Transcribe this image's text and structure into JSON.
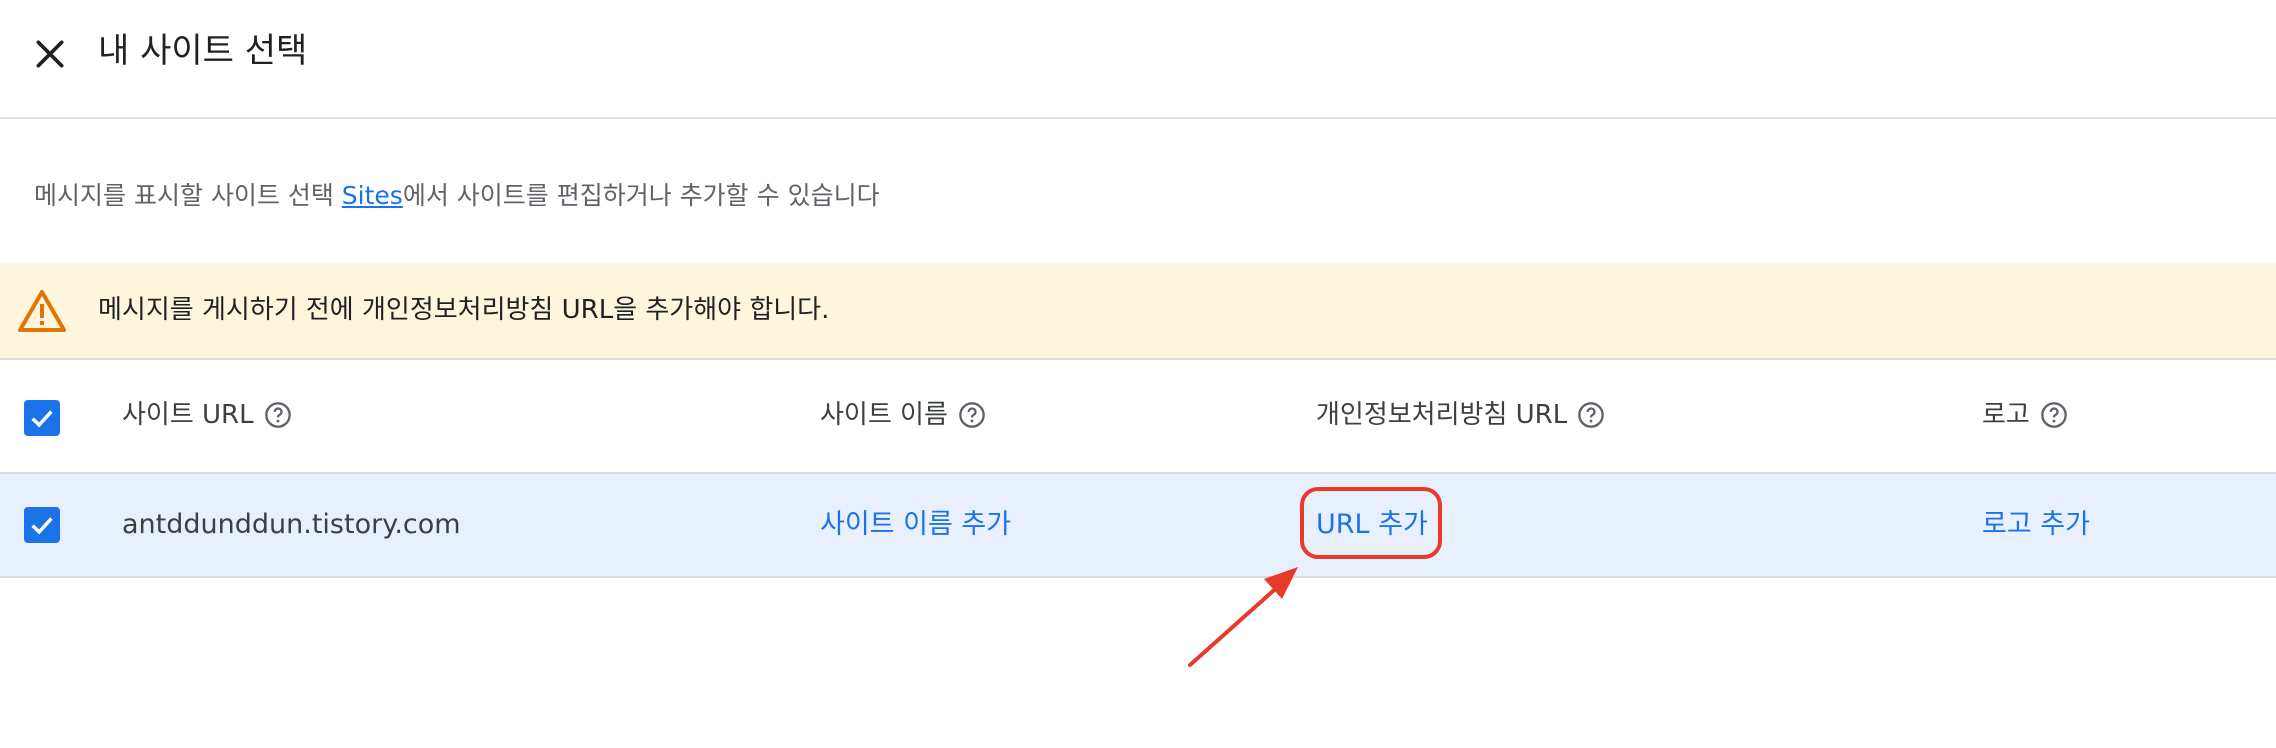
{
  "header": {
    "title": "내 사이트 선택",
    "close_icon": "close-icon"
  },
  "description": {
    "prefix": "메시지를 표시할 사이트 선택 ",
    "link_text": "Sites",
    "suffix": "에서 사이트를 편집하거나 추가할 수 있습니다"
  },
  "warning": {
    "icon": "warning-icon",
    "text": "메시지를 게시하기 전에 개인정보처리방침 URL을 추가해야 합니다.",
    "color": "#fdf6dc"
  },
  "table": {
    "columns": [
      {
        "label": "사이트 URL"
      },
      {
        "label": "사이트 이름"
      },
      {
        "label": "개인정보처리방침 URL"
      },
      {
        "label": "로고"
      }
    ],
    "rows": [
      {
        "selected": true,
        "site_url": "antddunddun.tistory.com",
        "site_name_action": "사이트 이름 추가",
        "privacy_url_action": "URL 추가",
        "logo_action": "로고 추가"
      }
    ]
  },
  "colors": {
    "accent": "#1a73e8",
    "annotation": "#e8392b",
    "row_selected": "#e8f0fe"
  }
}
